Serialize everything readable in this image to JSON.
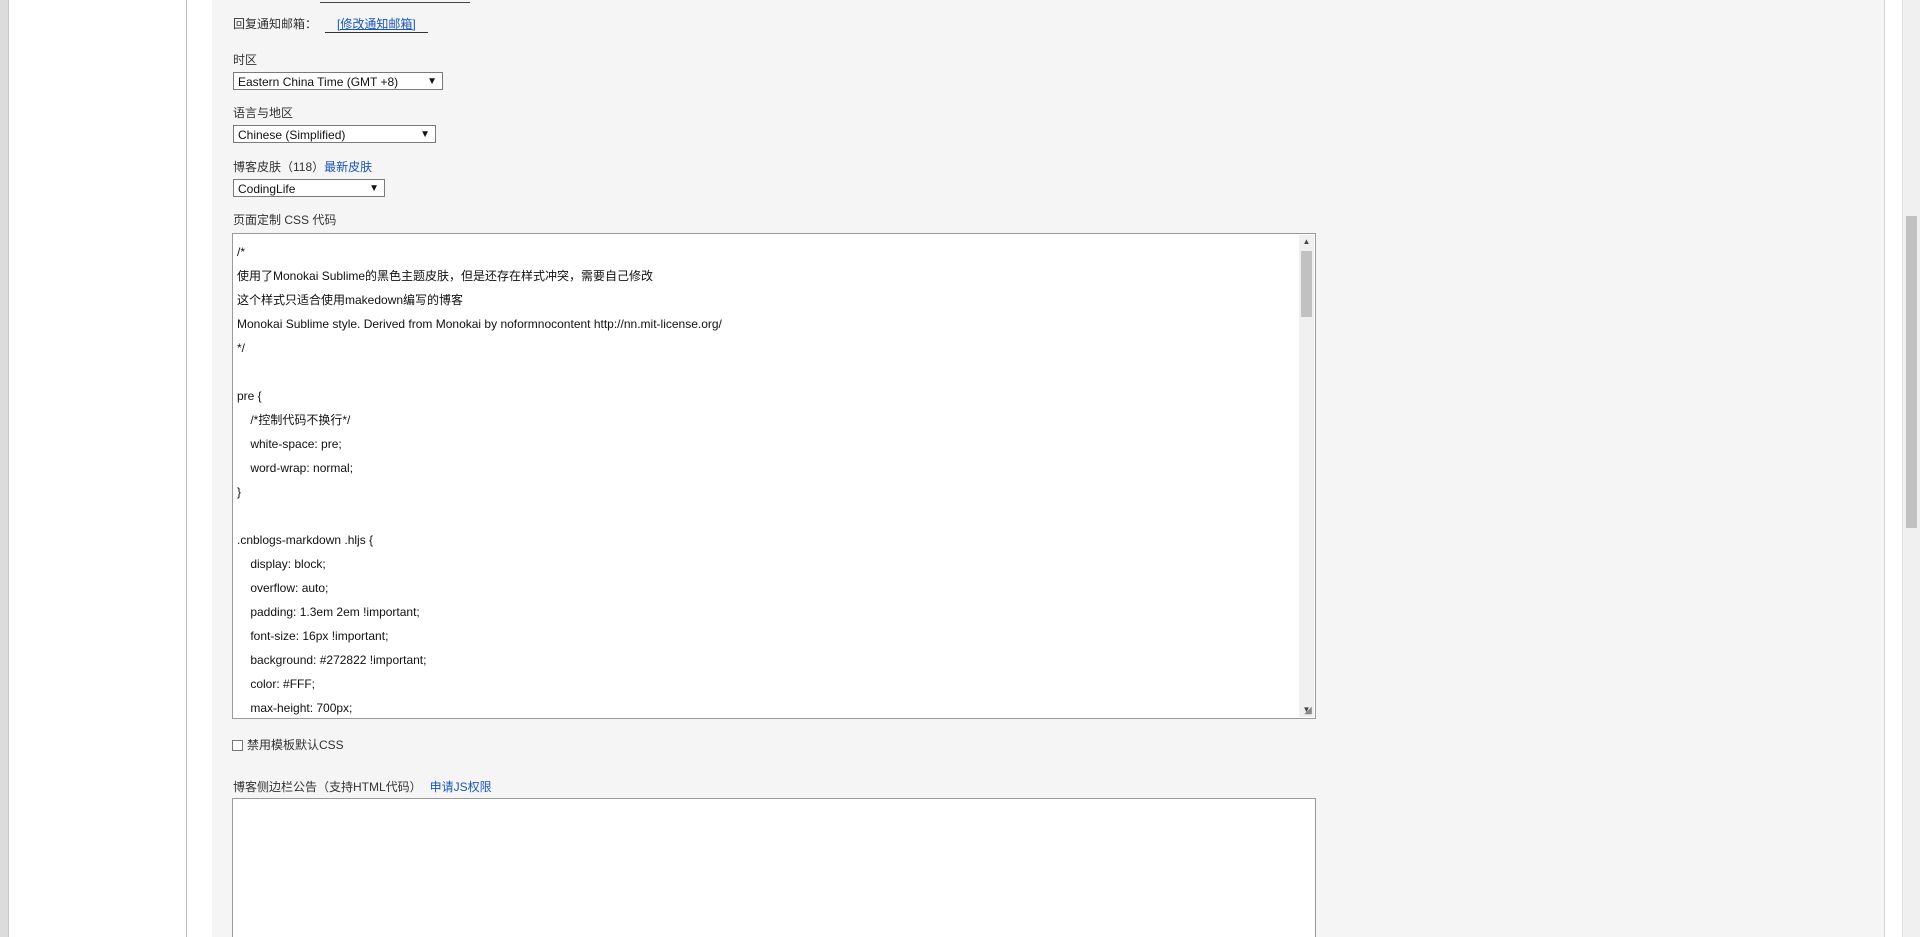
{
  "reply_email": {
    "label": "回复通知邮箱：",
    "link": "[修改通知邮箱]"
  },
  "timezone": {
    "label": "时区",
    "selected": "Eastern China Time (GMT +8)"
  },
  "language": {
    "label": "语言与地区",
    "selected": "Chinese (Simplified)"
  },
  "skin": {
    "label": "博客皮肤（118）",
    "latest_link": "最新皮肤",
    "selected": "CodingLife"
  },
  "css": {
    "label": "页面定制 CSS 代码",
    "lines": [
      "/*",
      "使用了Monokai Sublime的黑色主题皮肤，但是还存在样式冲突，需要自己修改",
      "这个样式只适合使用makedown编写的博客",
      "Monokai Sublime style. Derived from Monokai by noformnocontent http://nn.mit-license.org/",
      "*/",
      "",
      "pre {",
      "    /*控制代码不换行*/",
      "    white-space: pre;",
      "    word-wrap: normal;",
      "}",
      "",
      ".cnblogs-markdown .hljs {",
      "    display: block;",
      "    overflow: auto;",
      "    padding: 1.3em 2em !important;",
      "    font-size: 16px !important;",
      "    background: #272822 !important;",
      "    color: #FFF;",
      "    max-height: 700px;"
    ]
  },
  "disable_default_css": {
    "label": "禁用模板默认CSS"
  },
  "sidebar_notice": {
    "label": "博客侧边栏公告（支持HTML代码）",
    "js_link": "申请JS权限"
  },
  "icons": {
    "dropdown": "chevron-down-icon",
    "scroll_up": "arrow-up-icon",
    "scroll_down": "arrow-down-icon",
    "resize": "resize-grip-icon"
  }
}
